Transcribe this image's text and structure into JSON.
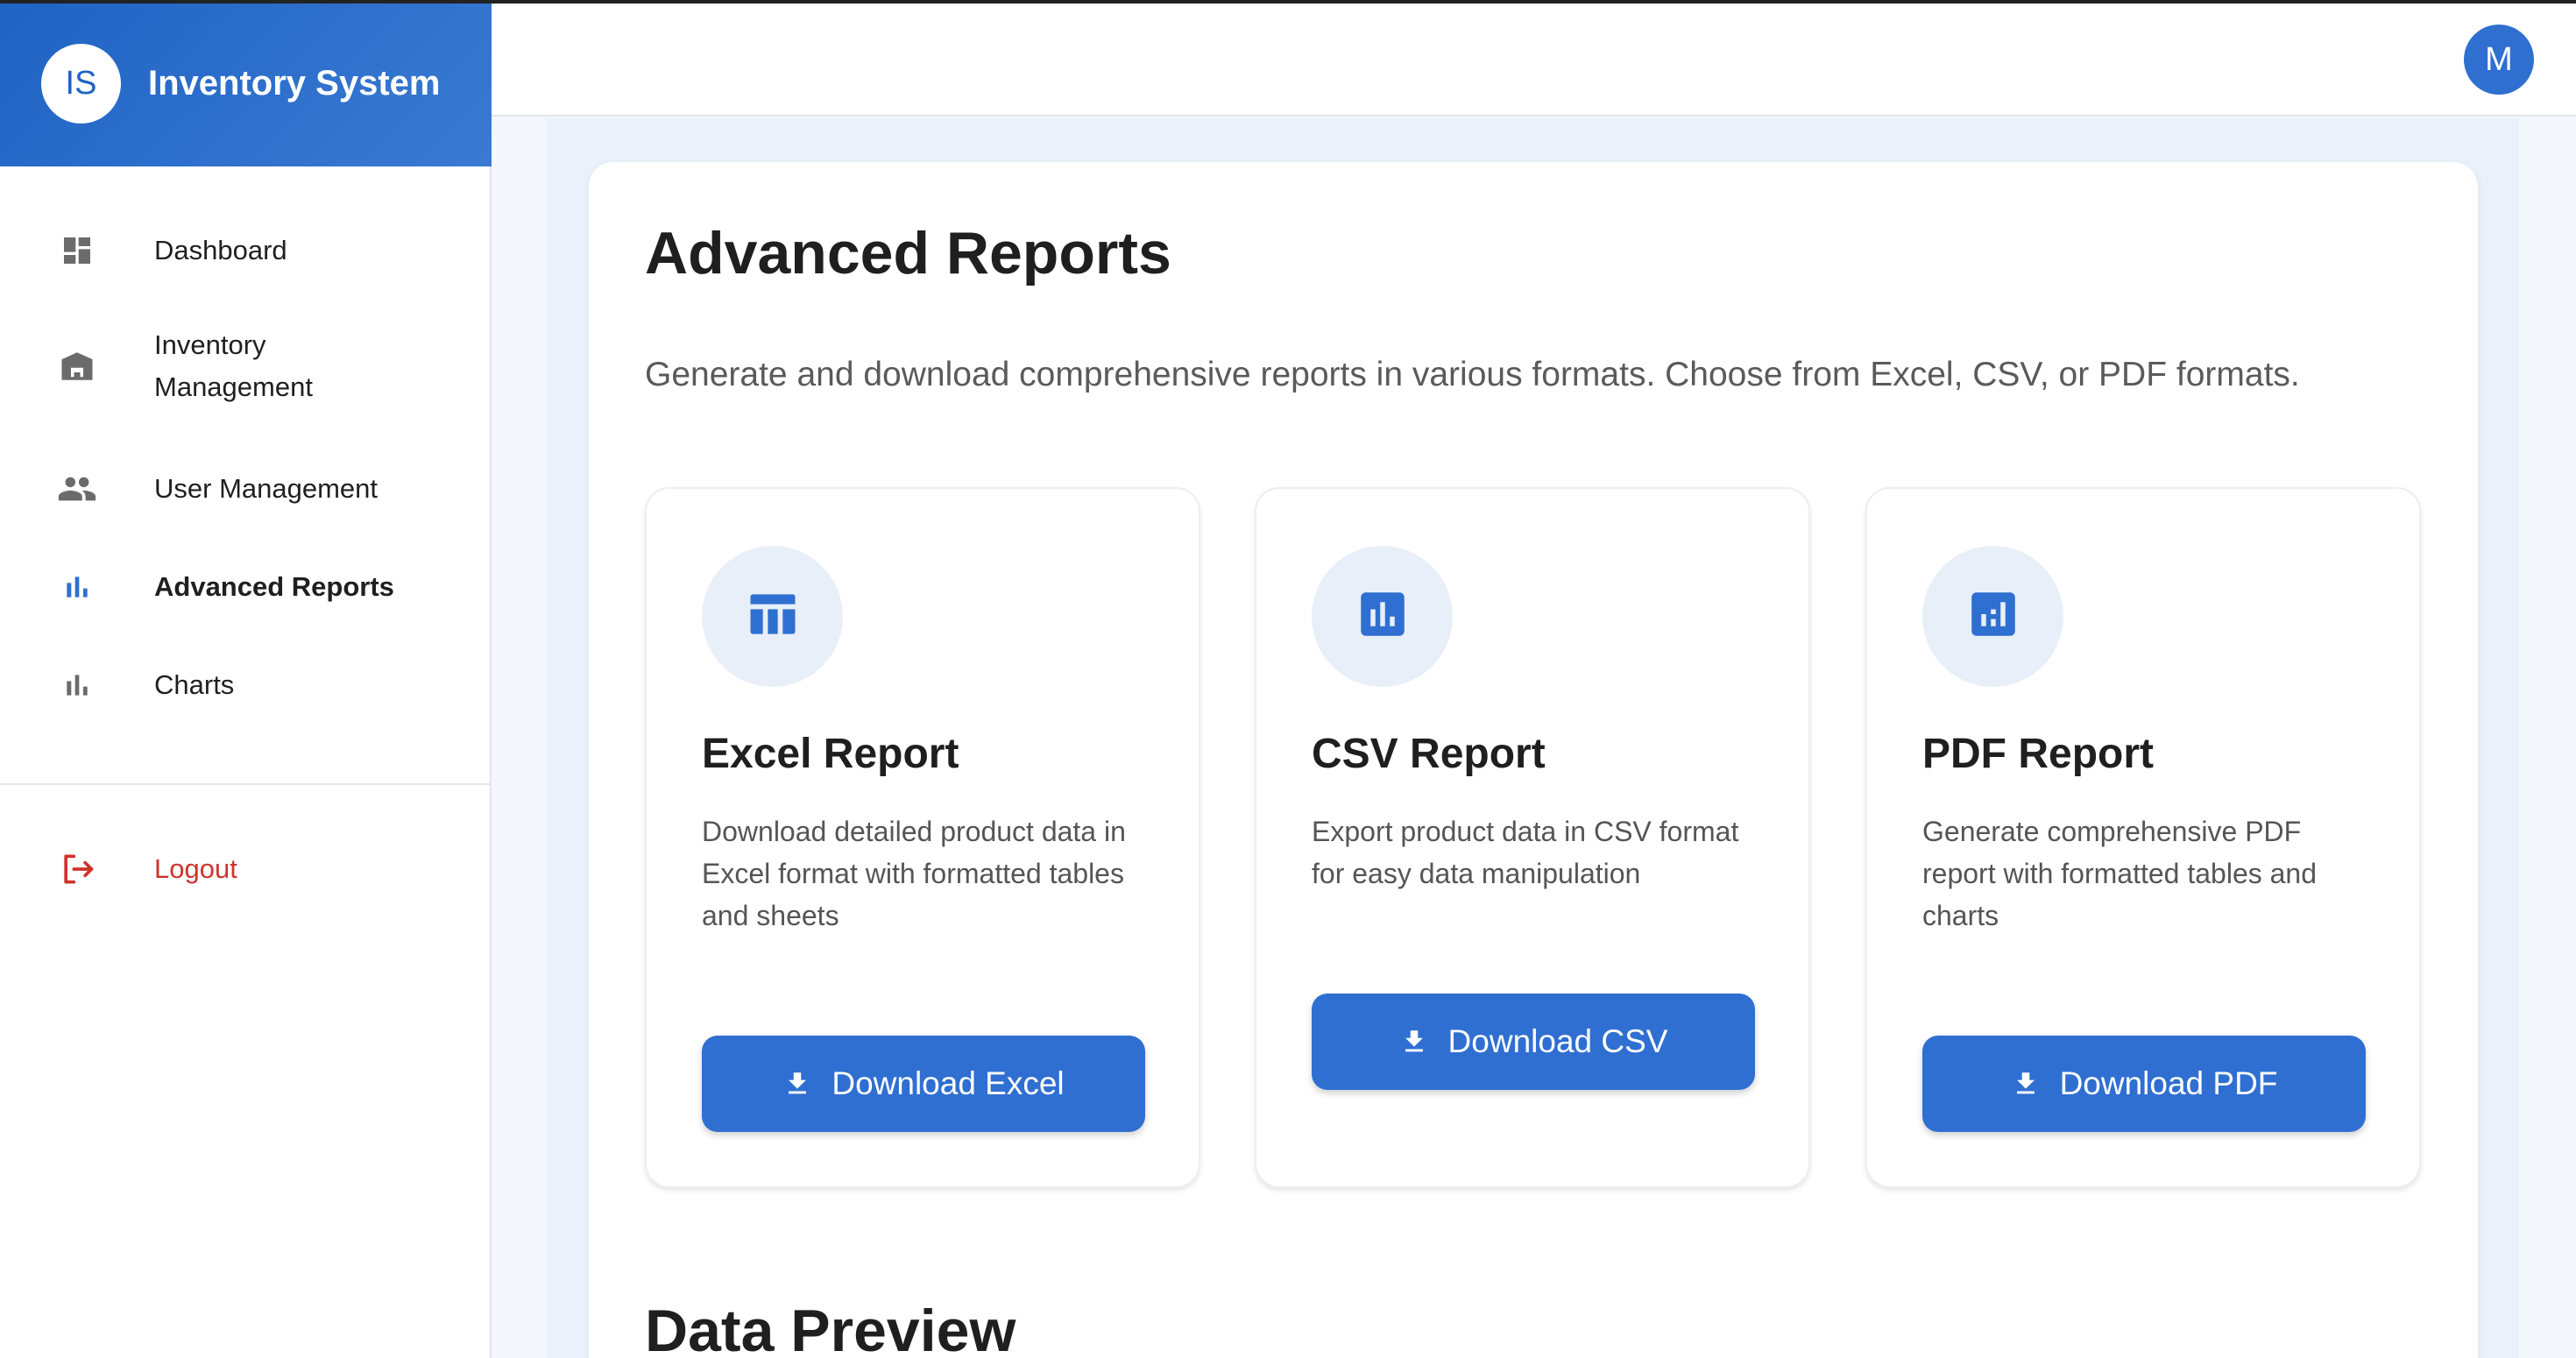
{
  "app": {
    "logo_text": "IS",
    "title": "Inventory System"
  },
  "sidebar": {
    "items": [
      {
        "label": "Dashboard",
        "icon": "dashboard-icon"
      },
      {
        "label": "Inventory",
        "label2": "Management",
        "icon": "warehouse-icon"
      },
      {
        "label": "User Management",
        "icon": "people-icon"
      },
      {
        "label": "Advanced Reports",
        "icon": "bar-chart-icon",
        "active": true
      },
      {
        "label": "Charts",
        "icon": "bar-chart-icon"
      }
    ],
    "logout": {
      "label": "Logout",
      "icon": "logout-icon"
    }
  },
  "header": {
    "avatar_initial": "M"
  },
  "page": {
    "title": "Advanced Reports",
    "description": "Generate and download comprehensive reports in various formats. Choose from Excel, CSV, or PDF formats."
  },
  "cards": [
    {
      "title": "Excel Report",
      "description": "Download detailed product data in Excel format with formatted tables and sheets",
      "button": "Download Excel",
      "icon": "table-icon"
    },
    {
      "title": "CSV Report",
      "description": "Export product data in CSV format for easy data manipulation",
      "button": "Download CSV",
      "icon": "bar-chart-box-icon"
    },
    {
      "title": "PDF Report",
      "description": "Generate comprehensive PDF report with formatted tables and charts",
      "button": "Download PDF",
      "icon": "analytics-box-icon"
    }
  ],
  "preview": {
    "title": "Data Preview"
  },
  "colors": {
    "primary": "#2f6fd1",
    "brand_gradient_start": "#1f63c4",
    "logout": "#d0322c",
    "icon_bg": "#e8eff9"
  }
}
